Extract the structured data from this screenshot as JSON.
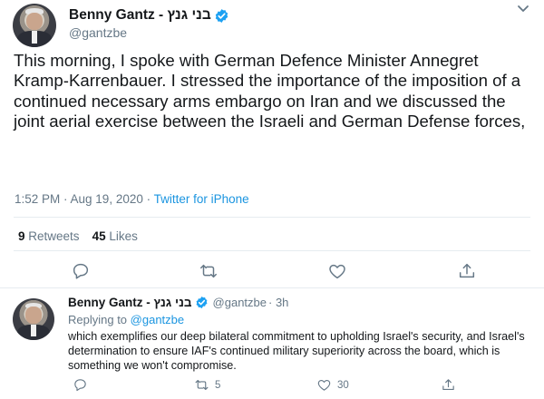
{
  "main_tweet": {
    "display_name": "Benny Gantz - בני גנץ",
    "handle": "@gantzbe",
    "text": "This morning, I spoke with German Defence Minister Annegret Kramp-Karrenbauer. I stressed the importance of the imposition of a continued necessary arms embargo on Iran and we discussed the joint aerial exercise between the Israeli and German Defense forces,",
    "timestamp": "1:52 PM · Aug 19, 2020 ·",
    "source": "Twitter for iPhone",
    "retweets_count": "9",
    "retweets_label": "Retweets",
    "likes_count": "45",
    "likes_label": "Likes",
    "icons": [
      "reply-icon",
      "retweet-icon",
      "like-icon",
      "share-icon",
      "more-caret-icon",
      "verified-badge-icon"
    ]
  },
  "reply_tweet": {
    "display_name": "Benny Gantz - בני גנץ",
    "handle": "@gantzbe",
    "time": "· 3h",
    "replying_label": "Replying to",
    "replying_to": "@gantzbe",
    "text": "which exemplifies our deep bilateral commitment to upholding Israel's security, and Israel's determination to ensure IAF's continued military superiority across the board, which is something we won't compromise.",
    "retweet_count": "5",
    "like_count": "30"
  },
  "colors": {
    "text": "#14171a",
    "secondary": "#657786",
    "link": "#1b95e0",
    "verified": "#1da1f2",
    "divider": "#e6ecf0"
  }
}
